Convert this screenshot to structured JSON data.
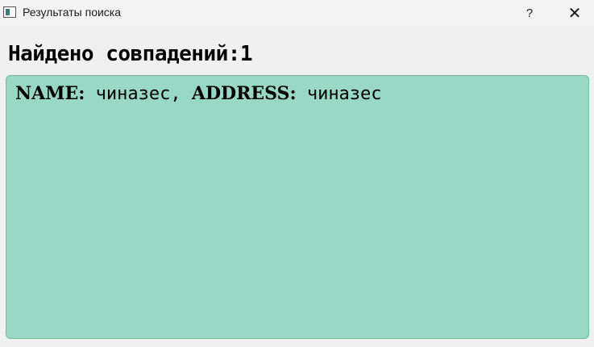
{
  "window": {
    "title": "Результаты поиска",
    "help_label": "?",
    "close_label": "✕"
  },
  "main": {
    "heading": "Найдено совпадений:1",
    "result": {
      "name_key": "NAME:",
      "name_value": " чиназес, ",
      "address_key": "ADDRESS:",
      "address_value": "  чиназес"
    }
  }
}
